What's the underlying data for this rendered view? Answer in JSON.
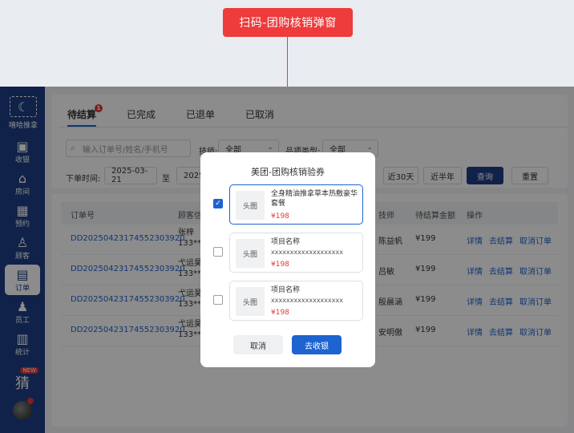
{
  "annotation": {
    "label": "扫码-团购核销弹窗"
  },
  "sidebar": {
    "logo_glyph": "☾",
    "logo_text": "嘻哈推拿",
    "items": [
      {
        "label": "收银",
        "icon": "cashier-icon",
        "glyph": "▣"
      },
      {
        "label": "房间",
        "icon": "house-icon",
        "glyph": "⌂"
      },
      {
        "label": "预约",
        "icon": "calendar-icon",
        "glyph": "▦"
      },
      {
        "label": "顾客",
        "icon": "user-icon",
        "glyph": "♙"
      },
      {
        "label": "订单",
        "icon": "order-icon",
        "glyph": "▤",
        "active": true
      },
      {
        "label": "员工",
        "icon": "staff-icon",
        "glyph": "♟"
      },
      {
        "label": "统计",
        "icon": "stats-icon",
        "glyph": "▥"
      }
    ],
    "extra_glyph": "猜",
    "new_badge": "NEW"
  },
  "tabs": [
    {
      "label": "待结算",
      "badge": "1",
      "active": true
    },
    {
      "label": "已完成"
    },
    {
      "label": "已退单"
    },
    {
      "label": "已取消"
    }
  ],
  "filters": {
    "search_icon": "⌕",
    "search_placeholder": "输入订单号/姓名/手机号",
    "tech_label": "技师:",
    "tech_value": "全部",
    "category_label": "品项类型:",
    "category_value": "全部",
    "time_label": "下单时间:",
    "date_start": "2025-03-21",
    "date_sep": "至",
    "date_end": "2025-0",
    "quick_30": "近30天",
    "quick_half": "近半年",
    "query": "查询",
    "reset": "重置"
  },
  "table": {
    "headers": [
      "订单号",
      "顾客信",
      "技师",
      "待结算金额",
      "操作"
    ],
    "rows": [
      {
        "order": "DD20250423174552303920",
        "customer": "张梓",
        "phone": "133***",
        "tech": "陈益帆",
        "amount": "¥199"
      },
      {
        "order": "DD20250423174552303920",
        "customer": "弋运昊",
        "phone": "133***",
        "tech": "吕敏",
        "amount": "¥199"
      },
      {
        "order": "DD20250423174552303920",
        "customer": "弋运昊",
        "phone": "133***",
        "tech": "殷晨涵",
        "amount": "¥199"
      },
      {
        "order": "DD20250423174552303920",
        "customer": "弋运昊",
        "phone": "133***",
        "tech": "安明傲",
        "amount": "¥199"
      }
    ],
    "actions": {
      "detail": "详情",
      "settle": "去结算",
      "cancel": "取消订单"
    }
  },
  "modal": {
    "title": "美团-团购核销验券",
    "thumb_label": "头图",
    "check_mark": "✓",
    "vouchers": [
      {
        "name": "全身精油推拿草本热敷豪华套餐",
        "price": "¥198",
        "checked": true
      },
      {
        "name": "项目名称",
        "code": "xxxxxxxxxxxxxxxxxxx",
        "price": "¥198",
        "checked": false
      },
      {
        "name": "项目名称",
        "code": "xxxxxxxxxxxxxxxxxxx",
        "price": "¥198",
        "checked": false
      }
    ],
    "cancel_label": "取消",
    "confirm_label": "去收银"
  }
}
